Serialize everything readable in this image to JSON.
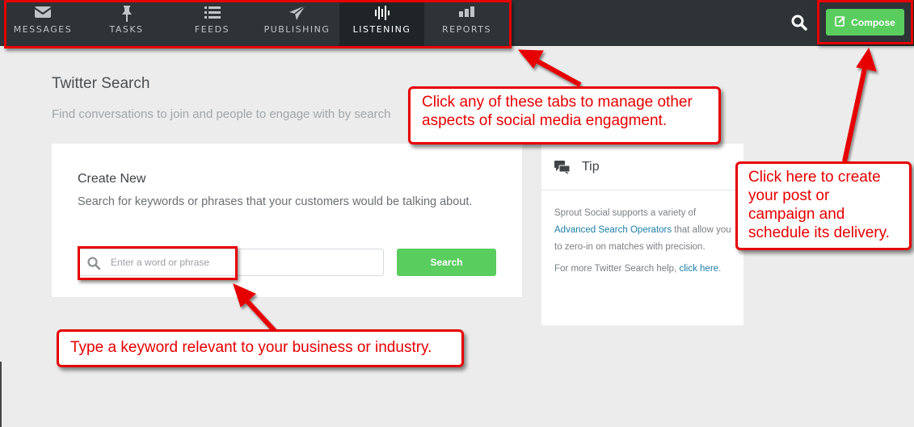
{
  "nav": {
    "tabs": [
      {
        "label": "MESSAGES",
        "icon": "envelope-icon"
      },
      {
        "label": "TASKS",
        "icon": "pin-icon"
      },
      {
        "label": "FEEDS",
        "icon": "list-icon"
      },
      {
        "label": "PUBLISHING",
        "icon": "paper-plane-icon"
      },
      {
        "label": "LISTENING",
        "icon": "waveform-icon",
        "active": true
      },
      {
        "label": "REPORTS",
        "icon": "bar-chart-icon"
      }
    ],
    "compose_label": "Compose"
  },
  "page": {
    "title": "Twitter Search",
    "subtitle": "Find conversations to join and people to engage with by search"
  },
  "create": {
    "title": "Create New",
    "description": "Search for keywords or phrases that your customers would be talking about.",
    "input_placeholder": "Enter a word or phrase",
    "search_label": "Search"
  },
  "tip": {
    "title": "Tip",
    "text1_before": "Sprout Social supports a variety of ",
    "text1_link": "Advanced Search Operators",
    "text1_after": " that allow you to zero-in on matches with precision.",
    "text2_before": "For more Twitter Search help, ",
    "text2_link": "click here",
    "text2_after": "."
  },
  "annotations": {
    "tabs_note": "Click any of these tabs to manage other aspects of social media engagment.",
    "compose_note": "Click here to create your post or campaign and schedule its delivery.",
    "keyword_note": "Type a keyword relevant to your business or industry."
  },
  "colors": {
    "accent_green": "#5acd5f",
    "nav_bg": "#2d3336",
    "annotation_red": "#e60000",
    "link_blue": "#1d7fa7"
  }
}
